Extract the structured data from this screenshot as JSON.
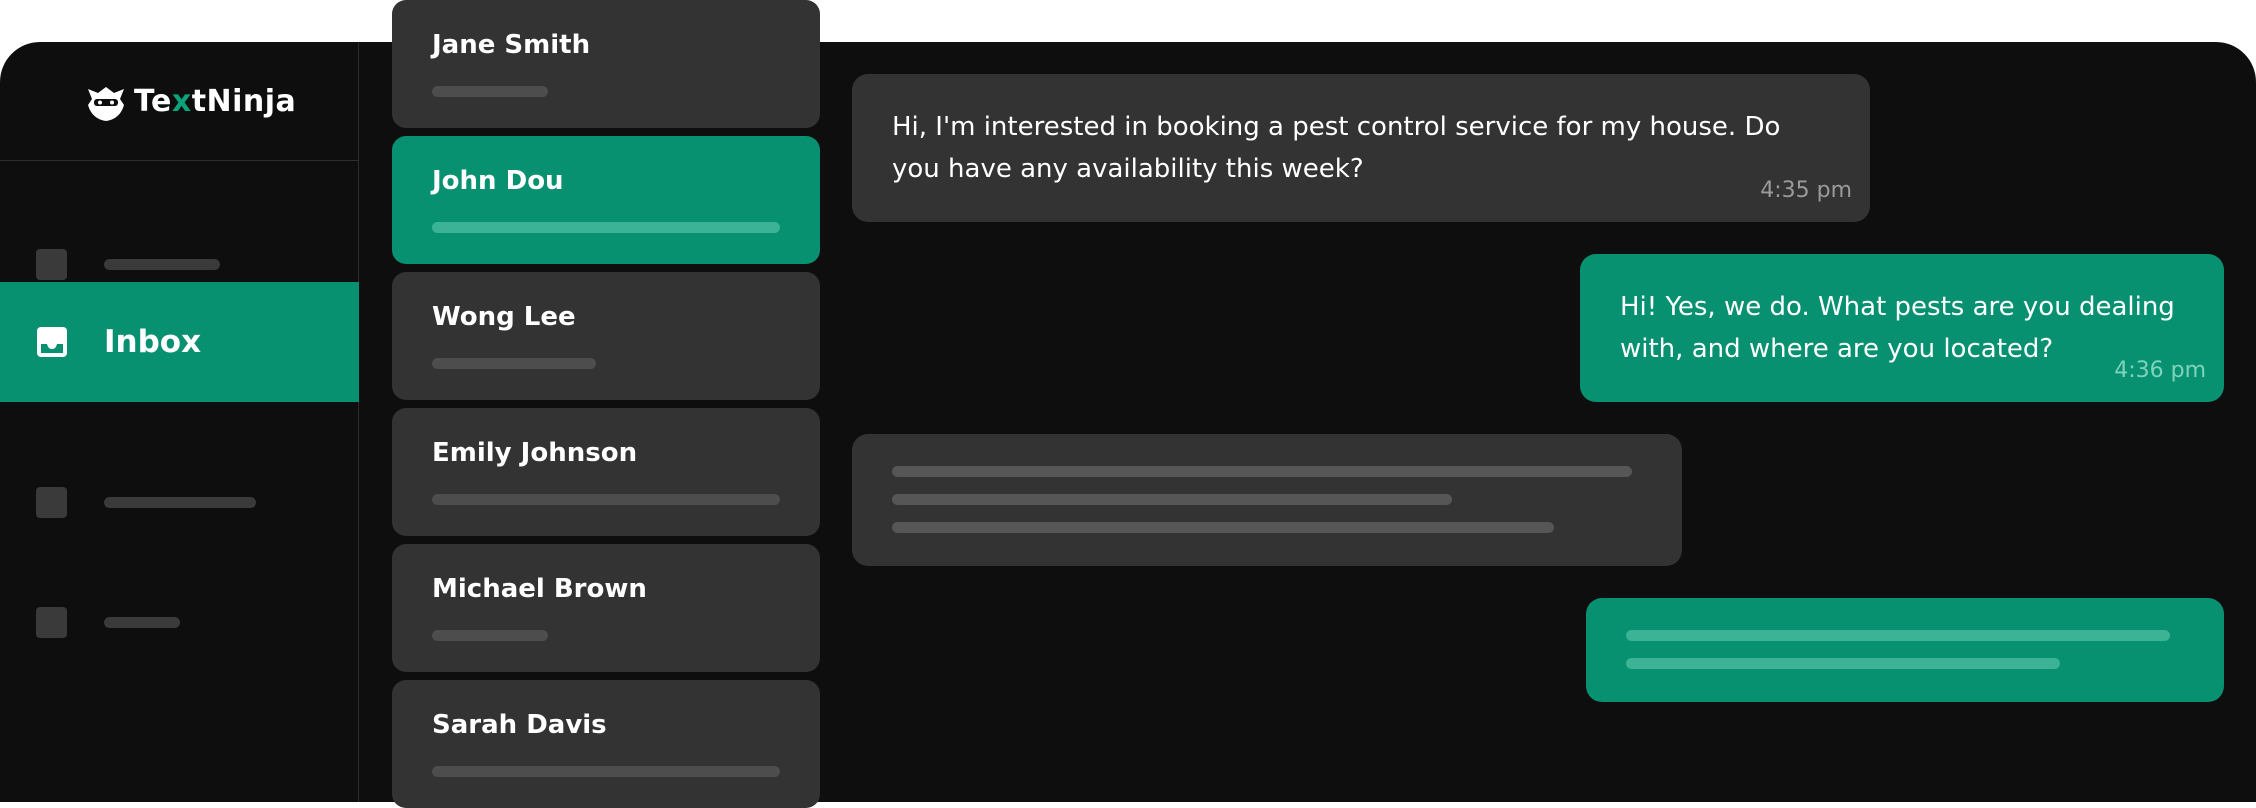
{
  "app": {
    "logo_text_before": "Te",
    "logo_text_x": "x",
    "logo_text_after": "tNinja"
  },
  "sidebar": {
    "items": [
      {
        "label": "",
        "active": false,
        "icon": "placeholder-square"
      },
      {
        "label": "Inbox",
        "active": true,
        "icon": "inbox-icon"
      },
      {
        "label": "",
        "active": false,
        "icon": "placeholder-square"
      },
      {
        "label": "",
        "active": false,
        "icon": "placeholder-square"
      }
    ]
  },
  "contacts": [
    {
      "name": "Jane Smith",
      "active": false
    },
    {
      "name": "John Dou",
      "active": true
    },
    {
      "name": "Wong Lee",
      "active": false
    },
    {
      "name": "Emily Johnson",
      "active": false
    },
    {
      "name": "Michael Brown",
      "active": false
    },
    {
      "name": "Sarah Davis",
      "active": false
    }
  ],
  "messages": [
    {
      "direction": "incoming",
      "text": "Hi, I'm interested in booking a pest control service for my house. Do you have any availability this week?",
      "time": "4:35 pm"
    },
    {
      "direction": "outgoing",
      "text": "Hi! Yes, we do. What pests are you dealing with, and where are you located?",
      "time": "4:36 pm"
    },
    {
      "direction": "incoming",
      "text": "",
      "time": ""
    },
    {
      "direction": "outgoing",
      "text": "",
      "time": ""
    }
  ],
  "colors": {
    "accent": "#079170",
    "background": "#0e0e0e",
    "card": "#333333"
  }
}
